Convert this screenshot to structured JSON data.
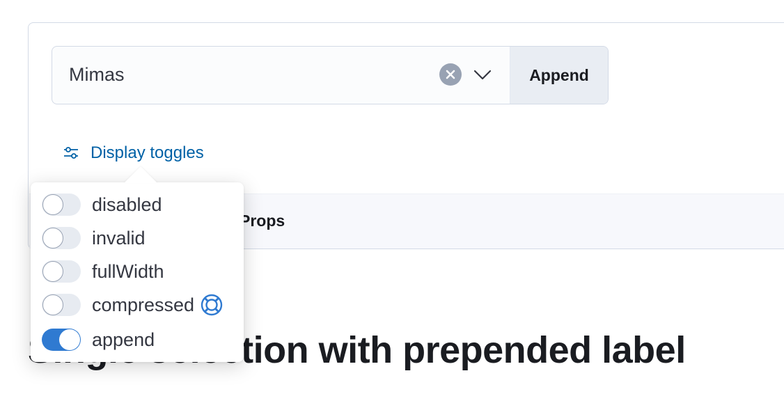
{
  "combo_box": {
    "selected_value": "Mimas",
    "append_label": "Append"
  },
  "display_toggles": {
    "link_label": "Display toggles",
    "items": [
      {
        "label": "disabled",
        "checked": false
      },
      {
        "label": "invalid",
        "checked": false
      },
      {
        "label": "fullWidth",
        "checked": false
      },
      {
        "label": "compressed",
        "checked": false,
        "has_help_icon": true
      },
      {
        "label": "append",
        "checked": true
      }
    ]
  },
  "props_tab": {
    "label": "Props"
  },
  "section": {
    "title": "Single selection with prepended label"
  },
  "colors": {
    "link": "#0061a6",
    "switch_on": "#2f7ad1",
    "append_bg": "#e9edf3"
  },
  "icons": [
    "clear-icon",
    "chevron-down-icon",
    "sliders-icon",
    "lifebuoy-icon"
  ]
}
